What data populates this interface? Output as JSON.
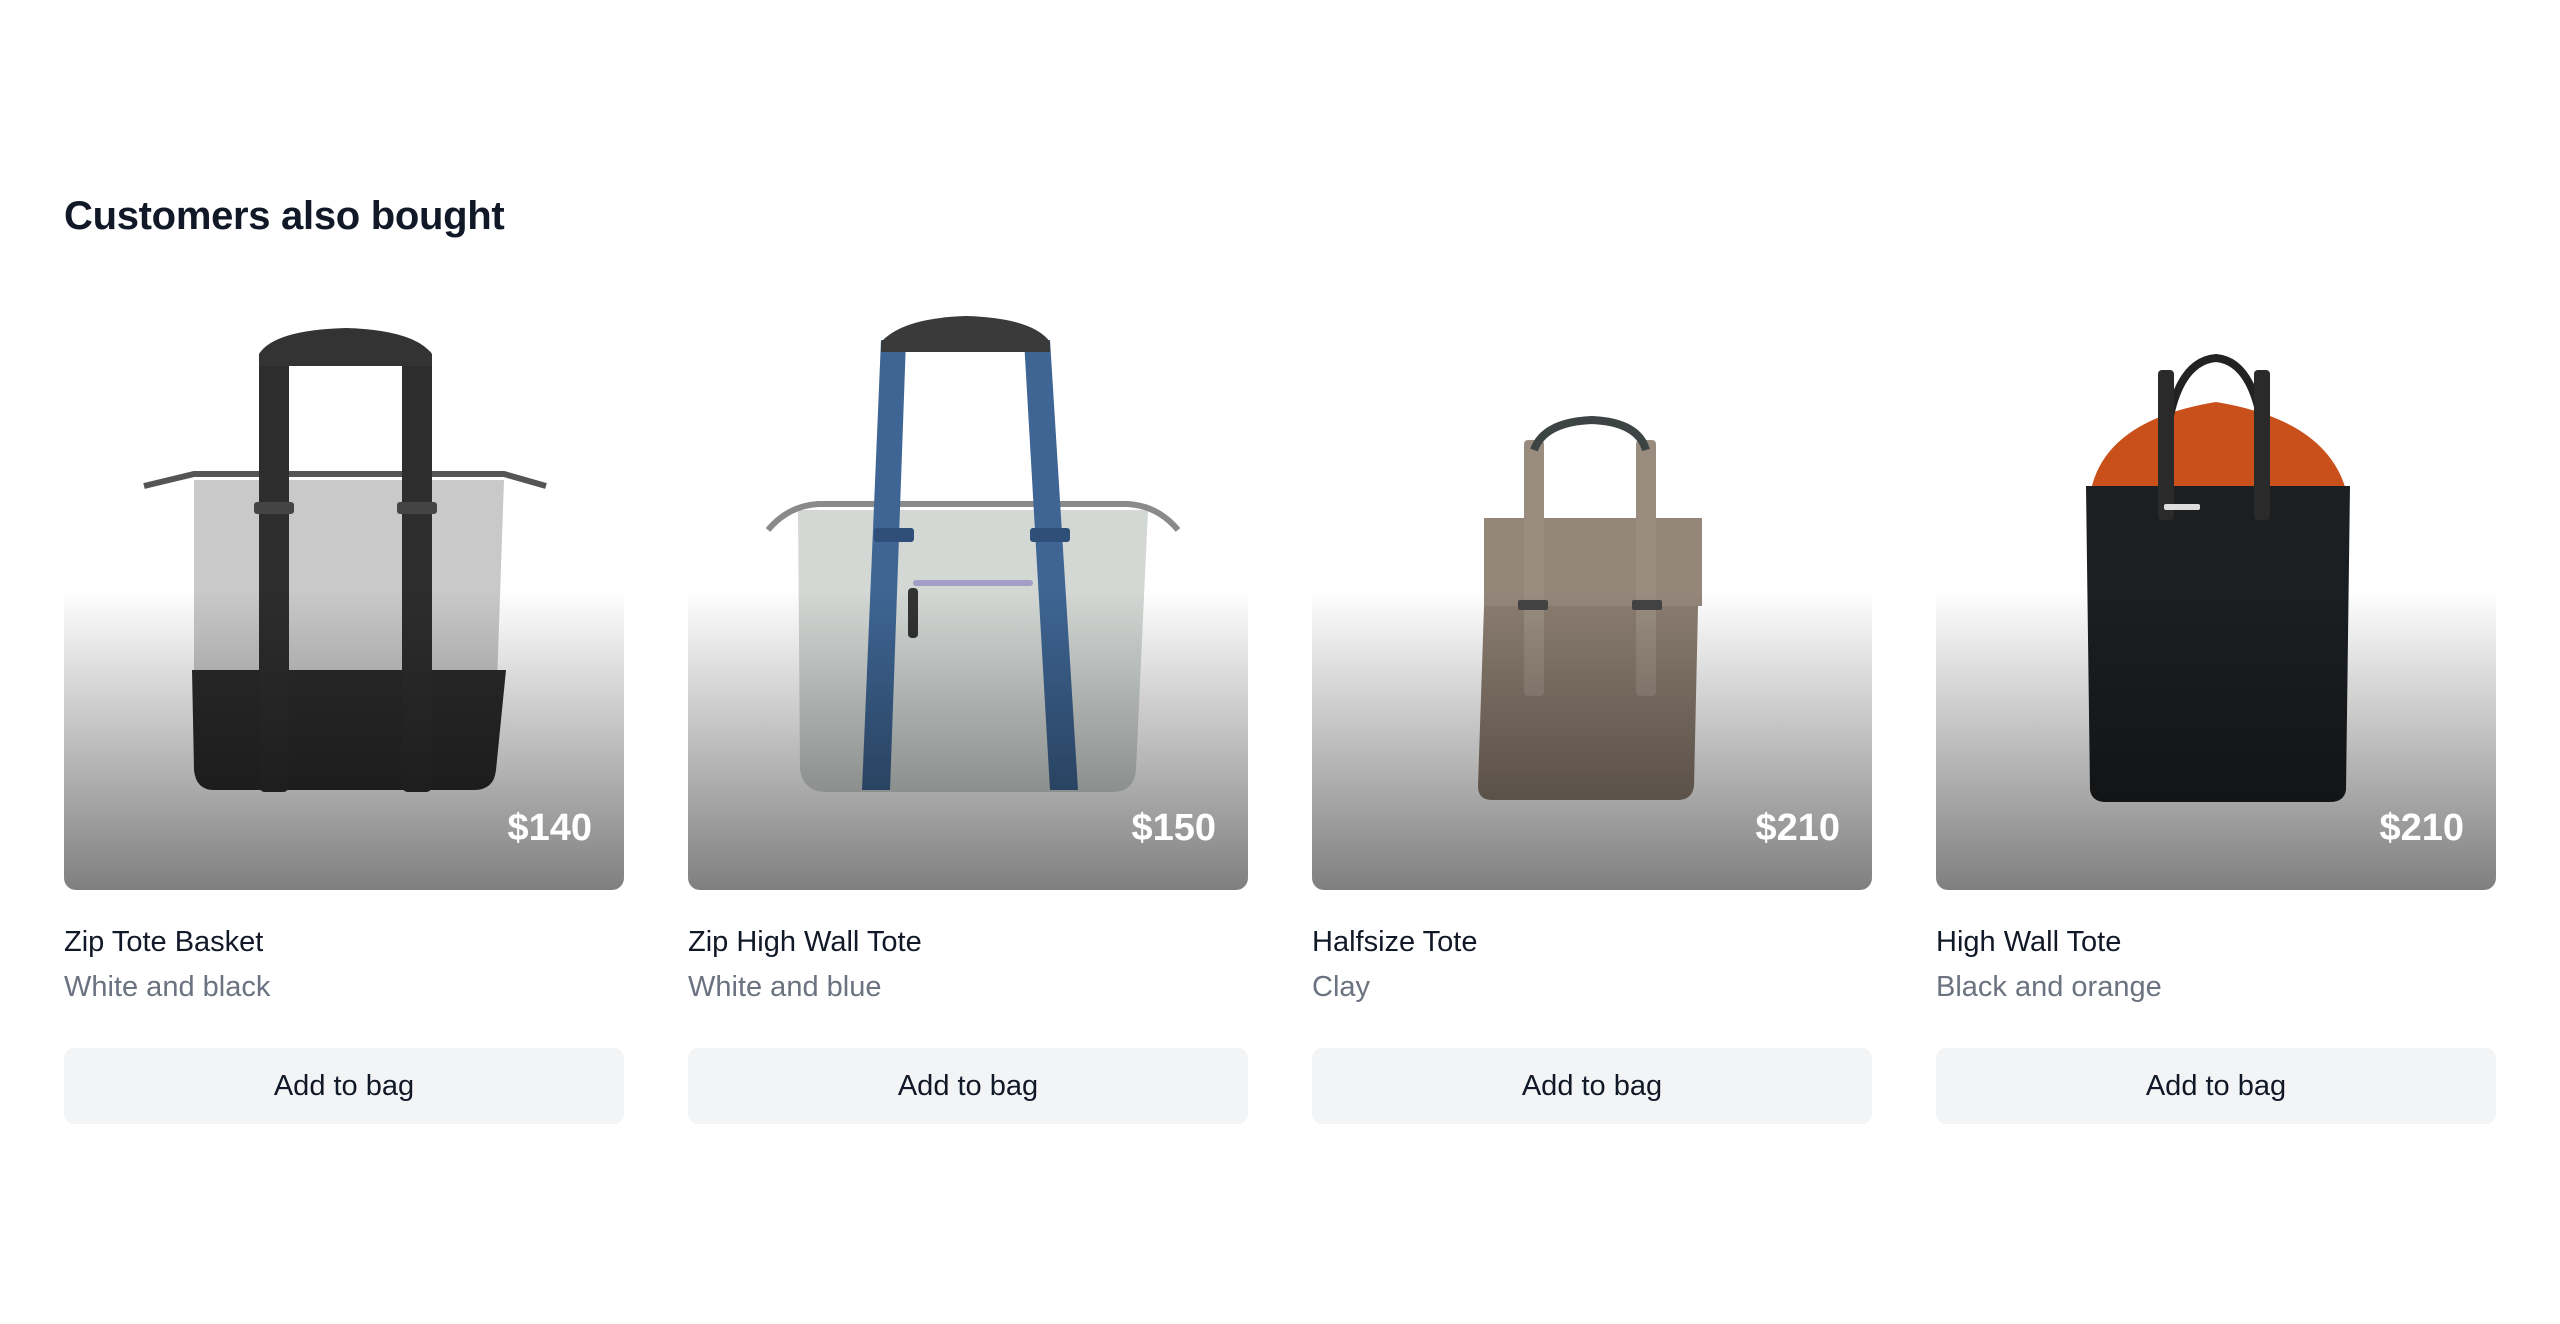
{
  "section": {
    "title": "Customers also bought"
  },
  "products": [
    {
      "name": "Zip Tote Basket",
      "variant": "White and black",
      "price": "$140",
      "cta": "Add to bag",
      "icon": "tote-bag-gray-black"
    },
    {
      "name": "Zip High Wall Tote",
      "variant": "White and blue",
      "price": "$150",
      "cta": "Add to bag",
      "icon": "tote-bag-white-blue"
    },
    {
      "name": "Halfsize Tote",
      "variant": "Clay",
      "price": "$210",
      "cta": "Add to bag",
      "icon": "tote-bag-clay"
    },
    {
      "name": "High Wall Tote",
      "variant": "Black and orange",
      "price": "$210",
      "cta": "Add to bag",
      "icon": "tote-bag-black-orange"
    }
  ],
  "colors": {
    "heading": "#111827",
    "muted": "#6b7280",
    "button_bg": "#f3f4f6"
  }
}
